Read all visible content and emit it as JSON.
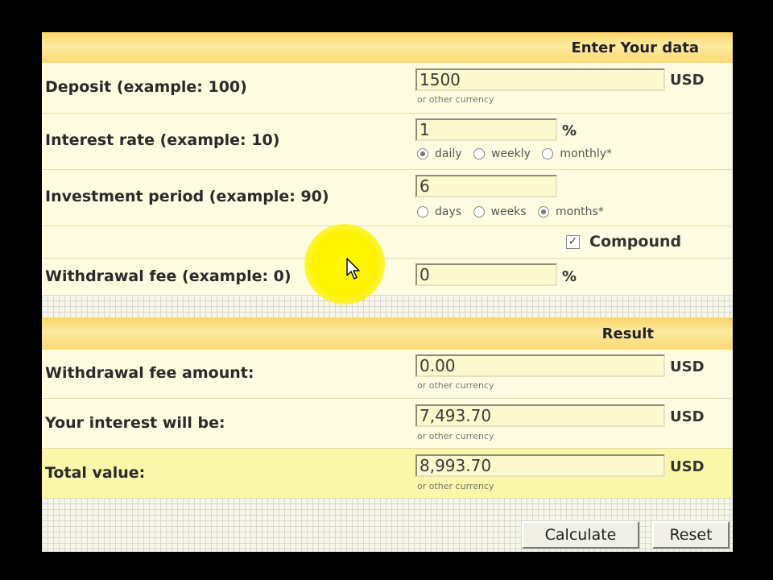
{
  "input_section": {
    "header": "Enter Your data",
    "deposit": {
      "label": "Deposit (example: 100)",
      "value": "1500",
      "unit": "USD",
      "sub": "or other currency"
    },
    "interest_rate": {
      "label": "Interest rate (example: 10)",
      "value": "1",
      "unit": "%",
      "options": [
        "daily",
        "weekly",
        "monthly*"
      ],
      "selected": "daily"
    },
    "period": {
      "label": "Investment period (example: 90)",
      "value": "6",
      "options": [
        "days",
        "weeks",
        "months*"
      ],
      "selected": "months*"
    },
    "compound": {
      "label": "Compound",
      "checked": true,
      "mark": "✓"
    },
    "withdrawal_fee": {
      "label": "Withdrawal fee (example: 0)",
      "value": "0",
      "unit": "%"
    }
  },
  "result_section": {
    "header": "Result",
    "fee_amount": {
      "label": "Withdrawal fee amount:",
      "value": "0.00",
      "unit": "USD",
      "sub": "or other currency"
    },
    "interest": {
      "label": "Your interest will be:",
      "value": "7,493.70",
      "unit": "USD",
      "sub": "or other currency"
    },
    "total": {
      "label": "Total value:",
      "value": "8,993.70",
      "unit": "USD",
      "sub": "or other currency"
    }
  },
  "buttons": {
    "calculate": "Calculate",
    "reset": "Reset"
  },
  "colors": {
    "header": "#fcd56a",
    "panel": "#fdfbd2",
    "highlight": "#fff200"
  }
}
